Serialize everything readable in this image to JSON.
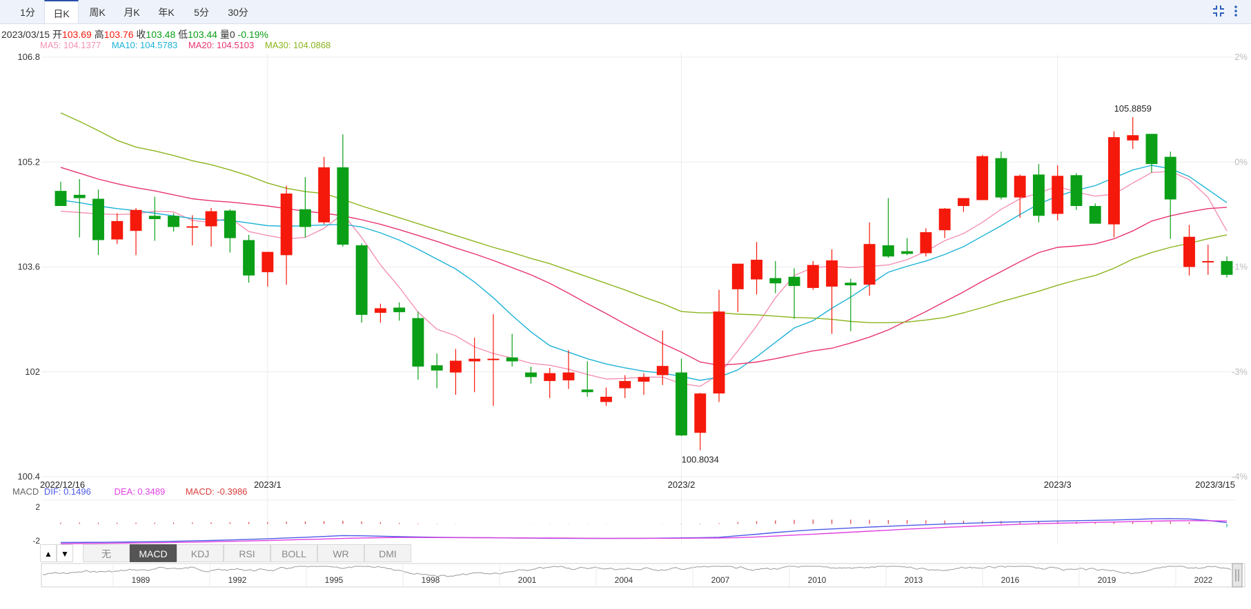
{
  "tabs": [
    {
      "label": "1分",
      "active": false
    },
    {
      "label": "日K",
      "active": true
    },
    {
      "label": "周K",
      "active": false
    },
    {
      "label": "月K",
      "active": false
    },
    {
      "label": "年K",
      "active": false
    },
    {
      "label": "5分",
      "active": false
    },
    {
      "label": "30分",
      "active": false
    }
  ],
  "toolbar": {
    "collapse_icon": "collapse-arrows-icon",
    "more_icon": "more-vertical-icon"
  },
  "info": {
    "date": "2023/03/15",
    "open_label": "开",
    "open": "103.69",
    "high_label": "高",
    "high": "103.76",
    "close_label": "收",
    "close": "103.48",
    "low_label": "低",
    "low": "103.44",
    "volume_label": "量",
    "volume": "0",
    "change": "-0.19%"
  },
  "ma": [
    {
      "label": "MA5: 104.1377",
      "color": "#f590b4"
    },
    {
      "label": "MA10: 104.5783",
      "color": "#1ab2d6"
    },
    {
      "label": "MA20: 104.5103",
      "color": "#e8336d"
    },
    {
      "label": "MA30: 104.0868",
      "color": "#8ab51c"
    }
  ],
  "colors": {
    "up": "#f5190b",
    "down": "#0a9f17",
    "grid": "#ececec",
    "axis_text": "#333333",
    "pct_text": "#bbbbbb"
  },
  "chart_data": [
    {
      "type": "candlestick",
      "ylim": [
        100.4,
        106.8
      ],
      "yticks": [
        "106.8",
        "105.2",
        "103.6",
        "102",
        "100.4"
      ],
      "pct_ticks": [
        "2%",
        "0%",
        "-1%",
        "-3%",
        "-4%"
      ],
      "xticks": [
        "2022/12/16",
        "2023/1",
        "2023/2",
        "2023/3",
        "2023/3/15"
      ],
      "annotations": {
        "high": "105.8859",
        "low": "100.8034"
      },
      "candles": [
        {
          "o": 104.76,
          "h": 104.9,
          "l": 104.55,
          "c": 104.53
        },
        {
          "o": 104.7,
          "h": 104.94,
          "l": 104.05,
          "c": 104.65
        },
        {
          "o": 104.64,
          "h": 104.78,
          "l": 103.78,
          "c": 104.01
        },
        {
          "o": 104.02,
          "h": 104.42,
          "l": 103.95,
          "c": 104.3
        },
        {
          "o": 104.15,
          "h": 104.5,
          "l": 103.78,
          "c": 104.47
        },
        {
          "o": 104.38,
          "h": 104.67,
          "l": 104.0,
          "c": 104.33
        },
        {
          "o": 104.38,
          "h": 104.42,
          "l": 104.14,
          "c": 104.21
        },
        {
          "o": 104.22,
          "h": 104.39,
          "l": 103.93,
          "c": 104.22
        },
        {
          "o": 104.22,
          "h": 104.5,
          "l": 103.91,
          "c": 104.45
        },
        {
          "o": 104.46,
          "h": 104.48,
          "l": 103.82,
          "c": 104.04
        },
        {
          "o": 104.01,
          "h": 104.09,
          "l": 103.36,
          "c": 103.47
        },
        {
          "o": 103.52,
          "h": 103.66,
          "l": 103.3,
          "c": 103.83
        },
        {
          "o": 103.78,
          "h": 104.84,
          "l": 103.33,
          "c": 104.72
        },
        {
          "o": 104.48,
          "h": 104.97,
          "l": 104.05,
          "c": 104.21
        },
        {
          "o": 104.28,
          "h": 105.28,
          "l": 104.25,
          "c": 105.12
        },
        {
          "o": 105.12,
          "h": 105.62,
          "l": 103.91,
          "c": 103.94
        },
        {
          "o": 103.93,
          "h": 103.96,
          "l": 102.75,
          "c": 102.87
        },
        {
          "o": 102.9,
          "h": 103.04,
          "l": 102.75,
          "c": 102.97
        },
        {
          "o": 102.98,
          "h": 103.06,
          "l": 102.78,
          "c": 102.91
        },
        {
          "o": 102.82,
          "h": 102.92,
          "l": 101.88,
          "c": 102.08
        },
        {
          "o": 102.1,
          "h": 102.28,
          "l": 101.75,
          "c": 102.02
        },
        {
          "o": 101.99,
          "h": 102.35,
          "l": 101.65,
          "c": 102.17
        },
        {
          "o": 102.16,
          "h": 102.52,
          "l": 101.69,
          "c": 102.2
        },
        {
          "o": 102.18,
          "h": 102.88,
          "l": 101.48,
          "c": 102.2
        },
        {
          "o": 102.22,
          "h": 102.58,
          "l": 102.08,
          "c": 102.16
        },
        {
          "o": 101.99,
          "h": 102.08,
          "l": 101.82,
          "c": 101.92
        },
        {
          "o": 101.86,
          "h": 102.06,
          "l": 101.6,
          "c": 101.98
        },
        {
          "o": 101.87,
          "h": 102.33,
          "l": 101.74,
          "c": 101.99
        },
        {
          "o": 101.73,
          "h": 102.16,
          "l": 101.62,
          "c": 101.69
        },
        {
          "o": 101.54,
          "h": 101.76,
          "l": 101.48,
          "c": 101.62
        },
        {
          "o": 101.75,
          "h": 101.95,
          "l": 101.6,
          "c": 101.86
        },
        {
          "o": 101.85,
          "h": 101.98,
          "l": 101.65,
          "c": 101.92
        },
        {
          "o": 101.95,
          "h": 102.63,
          "l": 101.8,
          "c": 102.09
        },
        {
          "o": 101.99,
          "h": 102.2,
          "l": 101.02,
          "c": 101.03
        },
        {
          "o": 101.07,
          "h": 101.68,
          "l": 100.8034,
          "c": 101.67
        },
        {
          "o": 101.67,
          "h": 103.25,
          "l": 101.54,
          "c": 102.92
        },
        {
          "o": 103.26,
          "h": 103.64,
          "l": 102.91,
          "c": 103.65
        },
        {
          "o": 103.41,
          "h": 103.98,
          "l": 103.18,
          "c": 103.71
        },
        {
          "o": 103.43,
          "h": 103.69,
          "l": 103.2,
          "c": 103.35
        },
        {
          "o": 103.45,
          "h": 103.58,
          "l": 102.81,
          "c": 103.31
        },
        {
          "o": 103.28,
          "h": 103.69,
          "l": 103.25,
          "c": 103.63
        },
        {
          "o": 103.3,
          "h": 103.87,
          "l": 102.58,
          "c": 103.7
        },
        {
          "o": 103.36,
          "h": 103.42,
          "l": 102.62,
          "c": 103.32
        },
        {
          "o": 103.33,
          "h": 104.28,
          "l": 103.16,
          "c": 103.95
        },
        {
          "o": 103.93,
          "h": 104.65,
          "l": 103.74,
          "c": 103.76
        },
        {
          "o": 103.84,
          "h": 104.04,
          "l": 103.78,
          "c": 103.8
        },
        {
          "o": 103.81,
          "h": 104.19,
          "l": 103.76,
          "c": 104.13
        },
        {
          "o": 104.16,
          "h": 104.5,
          "l": 104.04,
          "c": 104.49
        },
        {
          "o": 104.53,
          "h": 104.6,
          "l": 104.44,
          "c": 104.65
        },
        {
          "o": 104.62,
          "h": 105.31,
          "l": 104.62,
          "c": 105.29
        },
        {
          "o": 105.26,
          "h": 105.36,
          "l": 104.63,
          "c": 104.66
        },
        {
          "o": 104.66,
          "h": 105.01,
          "l": 104.35,
          "c": 104.99
        },
        {
          "o": 105.01,
          "h": 105.17,
          "l": 104.28,
          "c": 104.38
        },
        {
          "o": 104.41,
          "h": 105.15,
          "l": 104.31,
          "c": 104.99
        },
        {
          "o": 105.0,
          "h": 105.03,
          "l": 104.47,
          "c": 104.53
        },
        {
          "o": 104.53,
          "h": 104.57,
          "l": 104.28,
          "c": 104.26
        },
        {
          "o": 104.25,
          "h": 105.67,
          "l": 104.05,
          "c": 105.58
        },
        {
          "o": 105.53,
          "h": 105.8859,
          "l": 105.4,
          "c": 105.61
        },
        {
          "o": 105.63,
          "h": 105.63,
          "l": 105.04,
          "c": 105.17
        },
        {
          "o": 105.28,
          "h": 105.36,
          "l": 104.03,
          "c": 104.63
        },
        {
          "o": 103.6,
          "h": 104.24,
          "l": 103.47,
          "c": 104.06
        },
        {
          "o": 103.67,
          "h": 103.94,
          "l": 103.48,
          "c": 103.69
        },
        {
          "o": 103.69,
          "h": 103.76,
          "l": 103.44,
          "c": 103.48
        }
      ],
      "ma_series": [
        {
          "label": "MA5",
          "values": [
            104.45,
            104.43,
            104.41,
            104.4,
            104.41,
            104.45,
            104.44,
            104.31,
            104.28,
            104.35,
            104.14,
            104.08,
            104.03,
            104.05,
            104.19,
            104.41,
            104.05,
            103.63,
            103.29,
            102.91,
            102.65,
            102.55,
            102.38,
            102.28,
            102.21,
            102.13,
            102.1,
            102.04,
            101.96,
            101.89,
            101.9,
            101.92,
            101.92,
            101.82,
            101.78,
            101.96,
            102.32,
            102.7,
            103.13,
            103.47,
            103.59,
            103.61,
            103.59,
            103.61,
            103.63,
            103.71,
            103.84,
            104.0,
            104.11,
            104.28,
            104.48,
            104.64,
            104.73,
            104.83,
            104.74,
            104.68,
            104.71,
            104.88,
            105.04,
            105.06,
            104.93,
            104.66,
            104.15
          ]
        },
        {
          "label": "MA10",
          "values": [
            104.62,
            104.58,
            104.53,
            104.49,
            104.46,
            104.42,
            104.38,
            104.34,
            104.32,
            104.31,
            104.27,
            104.23,
            104.22,
            104.23,
            104.24,
            104.25,
            104.21,
            104.12,
            104.01,
            103.87,
            103.72,
            103.57,
            103.37,
            103.13,
            102.86,
            102.61,
            102.4,
            102.3,
            102.2,
            102.12,
            102.06,
            102.01,
            101.98,
            101.93,
            101.87,
            101.92,
            102.03,
            102.23,
            102.45,
            102.67,
            102.78,
            102.97,
            103.14,
            103.33,
            103.52,
            103.61,
            103.69,
            103.79,
            103.91,
            104.07,
            104.23,
            104.4,
            104.56,
            104.68,
            104.77,
            104.84,
            104.96,
            105.08,
            105.15,
            105.1,
            104.98,
            104.78,
            104.58
          ]
        },
        {
          "label": "MA20",
          "values": [
            105.12,
            105.03,
            104.94,
            104.87,
            104.81,
            104.76,
            104.7,
            104.64,
            104.61,
            104.59,
            104.56,
            104.53,
            104.49,
            104.45,
            104.42,
            104.38,
            104.32,
            104.25,
            104.17,
            104.08,
            103.99,
            103.89,
            103.8,
            103.7,
            103.59,
            103.48,
            103.35,
            103.2,
            103.04,
            102.89,
            102.73,
            102.58,
            102.43,
            102.3,
            102.15,
            102.1,
            102.12,
            102.15,
            102.2,
            102.26,
            102.32,
            102.36,
            102.44,
            102.53,
            102.64,
            102.78,
            102.92,
            103.07,
            103.22,
            103.38,
            103.53,
            103.68,
            103.82,
            103.9,
            103.92,
            103.95,
            104.03,
            104.15,
            104.3,
            104.38,
            104.44,
            104.49,
            104.51
          ]
        },
        {
          "label": "MA30",
          "values": [
            105.95,
            105.82,
            105.68,
            105.53,
            105.43,
            105.37,
            105.3,
            105.22,
            105.16,
            105.08,
            104.99,
            104.88,
            104.8,
            104.75,
            104.72,
            104.63,
            104.53,
            104.44,
            104.35,
            104.26,
            104.17,
            104.08,
            103.99,
            103.9,
            103.82,
            103.73,
            103.65,
            103.55,
            103.45,
            103.35,
            103.25,
            103.14,
            103.04,
            102.92,
            102.9,
            102.9,
            102.88,
            102.87,
            102.85,
            102.83,
            102.82,
            102.8,
            102.77,
            102.75,
            102.75,
            102.76,
            102.79,
            102.83,
            102.9,
            102.98,
            103.07,
            103.15,
            103.23,
            103.32,
            103.4,
            103.47,
            103.58,
            103.72,
            103.82,
            103.9,
            103.96,
            104.03,
            104.09
          ]
        }
      ]
    },
    {
      "type": "macd",
      "ylim": [
        -2.4,
        2.8
      ],
      "yticks": [
        "2",
        "-2"
      ],
      "dif": [
        -2.2,
        -2.18,
        -2.17,
        -2.15,
        -2.12,
        -2.1,
        -2.05,
        -2.0,
        -1.95,
        -1.9,
        -1.82,
        -1.76,
        -1.66,
        -1.58,
        -1.48,
        -1.38,
        -1.4,
        -1.45,
        -1.5,
        -1.55,
        -1.58,
        -1.6,
        -1.62,
        -1.64,
        -1.66,
        -1.68,
        -1.7,
        -1.7,
        -1.72,
        -1.72,
        -1.7,
        -1.7,
        -1.68,
        -1.65,
        -1.63,
        -1.58,
        -1.4,
        -1.22,
        -1.02,
        -0.85,
        -0.7,
        -0.6,
        -0.48,
        -0.38,
        -0.28,
        -0.18,
        -0.1,
        -0.02,
        0.06,
        0.13,
        0.2,
        0.25,
        0.3,
        0.34,
        0.38,
        0.42,
        0.46,
        0.52,
        0.6,
        0.62,
        0.58,
        0.4,
        0.15
      ],
      "dea": [
        -2.35,
        -2.32,
        -2.3,
        -2.27,
        -2.25,
        -2.22,
        -2.19,
        -2.15,
        -2.11,
        -2.06,
        -2.01,
        -1.96,
        -1.9,
        -1.84,
        -1.78,
        -1.72,
        -1.66,
        -1.63,
        -1.6,
        -1.6,
        -1.61,
        -1.62,
        -1.63,
        -1.64,
        -1.65,
        -1.66,
        -1.67,
        -1.68,
        -1.69,
        -1.7,
        -1.7,
        -1.7,
        -1.7,
        -1.69,
        -1.68,
        -1.66,
        -1.62,
        -1.54,
        -1.43,
        -1.32,
        -1.21,
        -1.1,
        -0.98,
        -0.86,
        -0.74,
        -0.62,
        -0.52,
        -0.42,
        -0.32,
        -0.22,
        -0.13,
        -0.05,
        0.02,
        0.08,
        0.13,
        0.18,
        0.22,
        0.27,
        0.32,
        0.36,
        0.38,
        0.37,
        0.35
      ],
      "macd": [
        0.15,
        0.15,
        0.14,
        0.14,
        0.15,
        0.14,
        0.16,
        0.17,
        0.18,
        0.18,
        0.21,
        0.22,
        0.26,
        0.28,
        0.32,
        0.37,
        0.28,
        0.2,
        0.12,
        0.06,
        0.03,
        0.02,
        0.01,
        0.0,
        -0.01,
        -0.02,
        -0.03,
        -0.02,
        -0.03,
        -0.02,
        0.0,
        0.0,
        0.02,
        0.04,
        0.05,
        0.08,
        0.22,
        0.32,
        0.41,
        0.47,
        0.51,
        0.5,
        0.5,
        0.48,
        0.46,
        0.44,
        0.42,
        0.4,
        0.38,
        0.35,
        0.33,
        0.3,
        0.28,
        0.26,
        0.25,
        0.24,
        0.24,
        0.25,
        0.28,
        0.26,
        0.2,
        0.03,
        -0.3986
      ],
      "labels": {
        "name": "MACD",
        "dif": "DIF: 0.1496",
        "dea": "DEA: 0.3489",
        "macd": "MACD: -0.3986"
      }
    }
  ],
  "macd_colors": {
    "dif": "#4a59e6",
    "dea": "#e040e0",
    "macd": "#d93b3b",
    "label": "#666666"
  },
  "indicator_tabs": [
    {
      "label": "无",
      "active": false
    },
    {
      "label": "MACD",
      "active": true
    },
    {
      "label": "KDJ",
      "active": false
    },
    {
      "label": "RSI",
      "active": false
    },
    {
      "label": "BOLL",
      "active": false
    },
    {
      "label": "WR",
      "active": false
    },
    {
      "label": "DMI",
      "active": false
    }
  ],
  "arrows": {
    "up": "▲",
    "down": "▼"
  },
  "navigator": {
    "years": [
      "1989",
      "1992",
      "1995",
      "1998",
      "2001",
      "2004",
      "2007",
      "2010",
      "2013",
      "2016",
      "2019",
      "2022"
    ]
  }
}
